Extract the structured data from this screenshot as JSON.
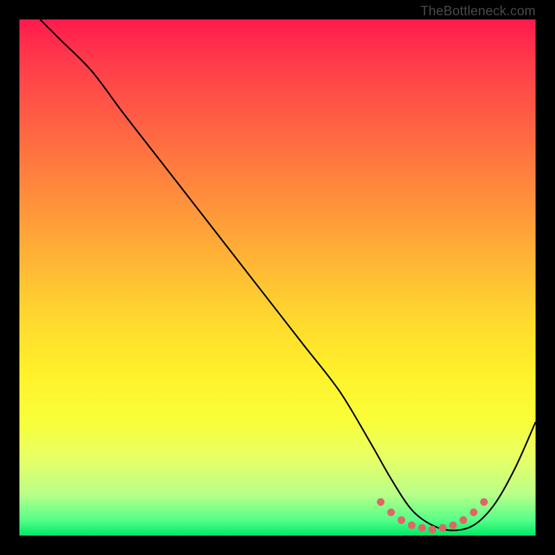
{
  "watermark": "TheBottleneck.com",
  "chart_data": {
    "type": "line",
    "title": "",
    "xlabel": "",
    "ylabel": "",
    "xlim": [
      0,
      100
    ],
    "ylim": [
      0,
      100
    ],
    "grid": false,
    "series": [
      {
        "name": "curve",
        "color": "#000000",
        "x": [
          4,
          8,
          14,
          20,
          27,
          34,
          41,
          48,
          55,
          62,
          68,
          72,
          76,
          80,
          84,
          88,
          92,
          96,
          100
        ],
        "y": [
          100,
          96,
          90,
          82,
          73,
          64,
          55,
          46,
          37,
          28,
          18,
          11,
          5,
          2,
          1,
          2,
          6,
          13,
          22
        ]
      },
      {
        "name": "highlight-dots",
        "color": "#e06666",
        "x": [
          70,
          72,
          74,
          76,
          78,
          80,
          82,
          84,
          86,
          88,
          90
        ],
        "y": [
          6.5,
          4.5,
          3.0,
          2.0,
          1.5,
          1.2,
          1.5,
          2.0,
          3.0,
          4.5,
          6.5
        ]
      }
    ],
    "gradient_description": "vertical red-to-green heat gradient, red at top (high bottleneck), green at bottom (low bottleneck)"
  }
}
